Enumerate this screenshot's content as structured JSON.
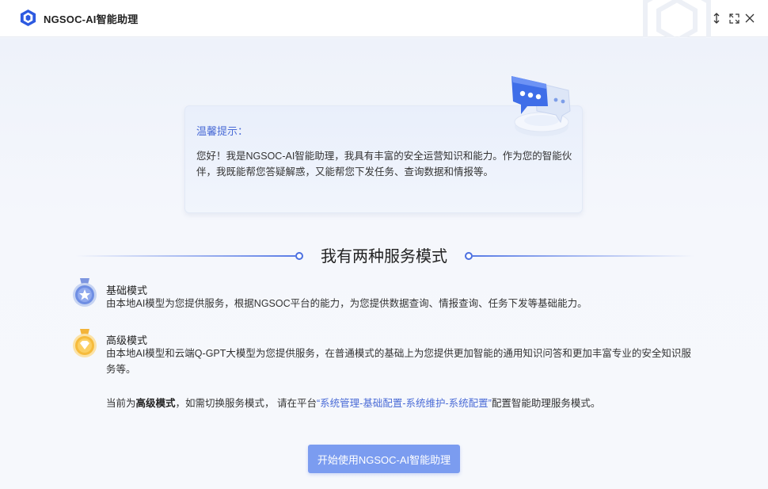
{
  "window": {
    "title": "NGSOC-AI智能助理"
  },
  "tip": {
    "title": "温馨提示：",
    "body": "您好！我是NGSOC-AI智能助理，我具有丰富的安全运营知识和能力。作为您的智能伙伴，我既能帮您答疑解惑，又能帮您下发任务、查询数据和情报等。"
  },
  "section": {
    "title": "我有两种服务模式"
  },
  "modes": [
    {
      "name": "基础模式",
      "description": "由本地AI模型为您提供服务，根据NGSOC平台的能力，为您提供数据查询、情报查询、任务下发等基础能力。",
      "icon": "silver-star-medal-icon"
    },
    {
      "name": "高级模式",
      "description": "由本地AI模型和云端Q-GPT大模型为您提供服务，在普通模式的基础上为您提供更加智能的通用知识问答和更加丰富专业的安全知识服务等。",
      "icon": "gold-diamond-medal-icon"
    }
  ],
  "status": {
    "prefix": "当前为",
    "current_mode": "高级模式",
    "middle": "，如需切换服务模式， 请在平台",
    "path": "“系统管理-基础配置-系统维护-系统配置”",
    "suffix": "配置智能助理服务模式。"
  },
  "start_button": {
    "label": "开始使用NGSOC-AI智能助理"
  },
  "colors": {
    "accent": "#4a6bd6",
    "button": "#7b9cf0",
    "background": "#f3f6fc"
  }
}
